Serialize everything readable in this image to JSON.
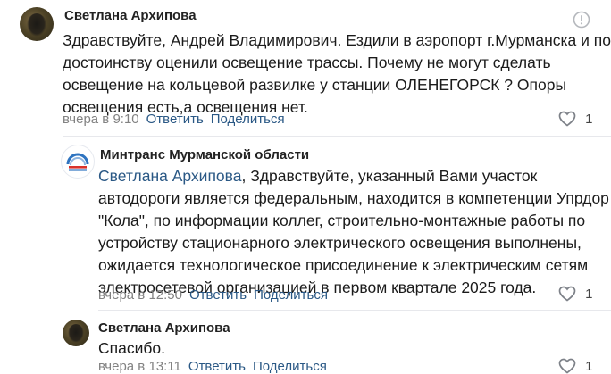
{
  "comments": [
    {
      "author": "Светлана Архипова",
      "lines": [
        "Здравствуйте, Андрей Владимирович. Ездили в аэропорт г.Мурманска и по",
        "достоинству оценили освещение трассы. Почему не могут сделать",
        "освещение на кольцевой развилке у станции ОЛЕНЕГОРСК ? Опоры",
        "освещения есть,а освещения нет."
      ],
      "time": "вчера в 9:10",
      "reply_label": "Ответить",
      "share_label": "Поделиться",
      "likes": "1"
    },
    {
      "author": "Минтранс Мурманской области",
      "mention": "Светлана Архипова",
      "first_line_rest": ", Здравствуйте, указанный Вами участок",
      "lines": [
        "автодороги является федеральным, находится в компетенции Упрдор",
        "\"Кола\", по информации коллег, строительно-монтажные работы по",
        "устройству стационарного электрического освещения выполнены,",
        "ожидается технологическое присоединение к электрическим сетям",
        "электросетевой организацией в первом квартале 2025 года."
      ],
      "time": "вчера в 12:50",
      "reply_label": "Ответить",
      "share_label": "Поделиться",
      "likes": "1"
    },
    {
      "author": "Светлана Архипова",
      "lines": [
        "Спасибо."
      ],
      "time": "вчера в 13:11",
      "reply_label": "Ответить",
      "share_label": "Поделиться",
      "likes": "1"
    }
  ],
  "icons": {
    "report": "report-icon",
    "like": "heart-icon",
    "mintrans_logo": "mintrans-logo-icon"
  },
  "colors": {
    "link": "#2a5885",
    "meta": "#828282",
    "logo_blue": "#2f74c0",
    "logo_red": "#d9322b"
  }
}
